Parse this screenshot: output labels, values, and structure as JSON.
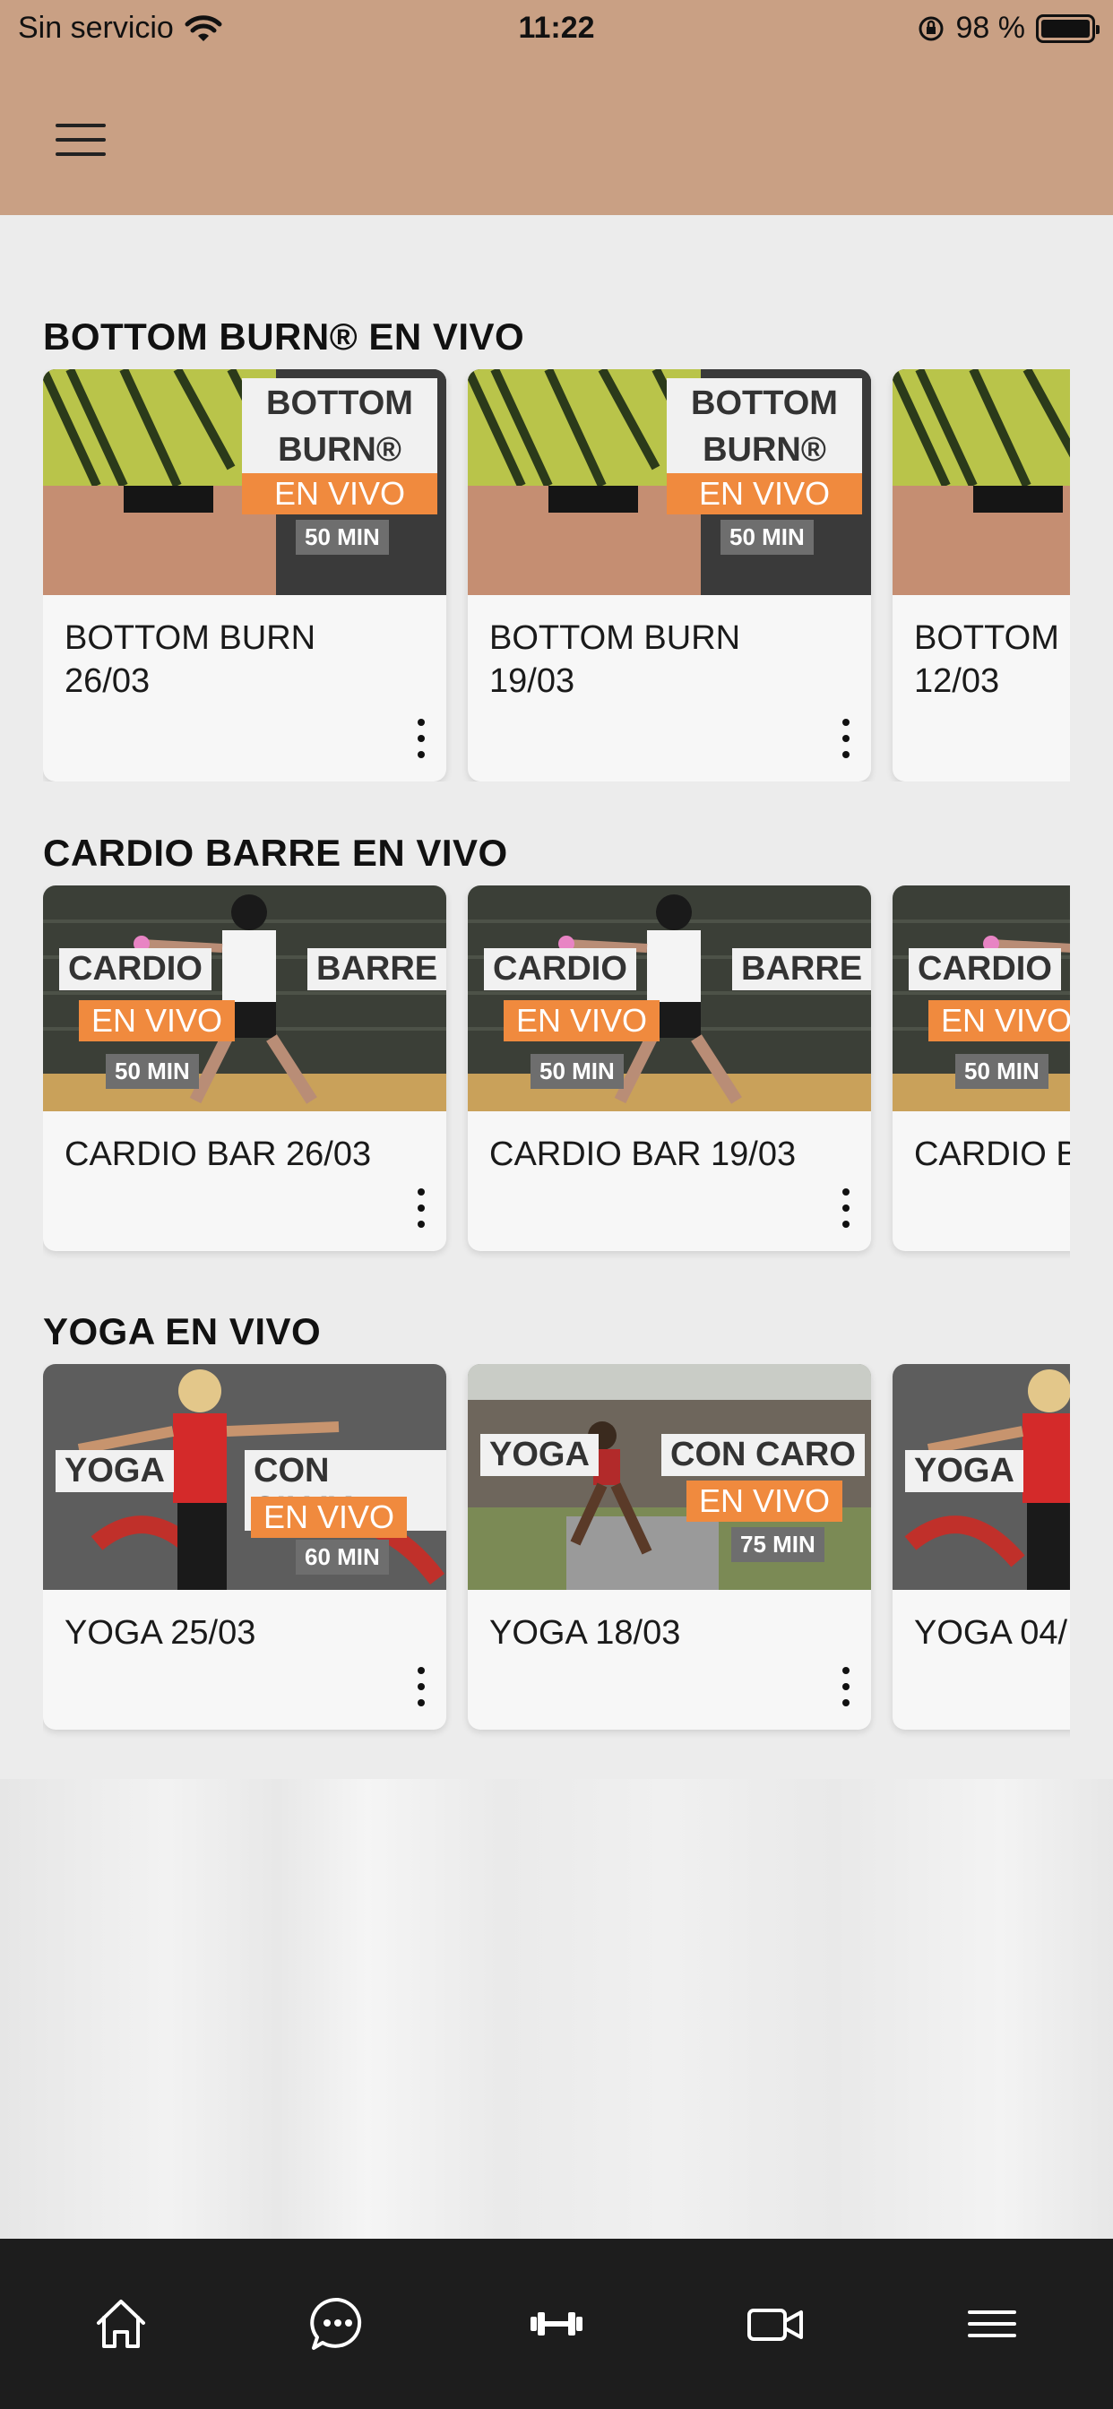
{
  "status_bar": {
    "carrier": "Sin servicio",
    "time": "11:22",
    "battery_percent": "98 %"
  },
  "sections": [
    {
      "title": "BOTTOM BURN® EN VIVO",
      "cards": [
        {
          "title_line1": "BOTTOM BURN",
          "title_line2": "26/03",
          "label_top": "BOTTOM",
          "label_top2": "BURN®",
          "label_live": "EN VIVO",
          "label_duration": "50 MIN"
        },
        {
          "title_line1": "BOTTOM BURN",
          "title_line2": "19/03",
          "label_top": "BOTTOM",
          "label_top2": "BURN®",
          "label_live": "EN VIVO",
          "label_duration": "50 MIN"
        },
        {
          "title_line1": "BOTTOM",
          "title_line2": "12/03"
        }
      ]
    },
    {
      "title": "CARDIO BARRE EN VIVO",
      "cards": [
        {
          "title_line1": "CARDIO BAR 26/03",
          "label_left": "CARDIO",
          "label_right": "BARRE",
          "label_live": "EN VIVO",
          "label_duration": "50 MIN"
        },
        {
          "title_line1": "CARDIO BAR 19/03",
          "label_left": "CARDIO",
          "label_right": "BARRE",
          "label_live": "EN VIVO",
          "label_duration": "50 MIN"
        },
        {
          "title_line1": "CARDIO B",
          "label_left": "CARDIO",
          "label_live": "EN VIVO",
          "label_duration": "50 MIN"
        }
      ]
    },
    {
      "title": "YOGA EN VIVO",
      "cards": [
        {
          "title_line1": "YOGA 25/03",
          "label_left": "YOGA",
          "label_right": "CON SILVIA",
          "label_live": "EN VIVO",
          "label_duration": "60 MIN"
        },
        {
          "title_line1": "YOGA 18/03",
          "label_left": "YOGA",
          "label_right": "CON CARO",
          "label_live": "EN VIVO",
          "label_duration": "75 MIN"
        },
        {
          "title_line1": "YOGA 04/",
          "label_left": "YOGA"
        }
      ]
    }
  ],
  "tab_bar": {
    "icons": [
      "home-icon",
      "chat-icon",
      "dumbbell-icon",
      "video-icon",
      "menu-icon"
    ]
  },
  "colors": {
    "header": "#c9a084",
    "accent_orange": "#f08a3e",
    "tab_bar": "#1d1d1d"
  }
}
